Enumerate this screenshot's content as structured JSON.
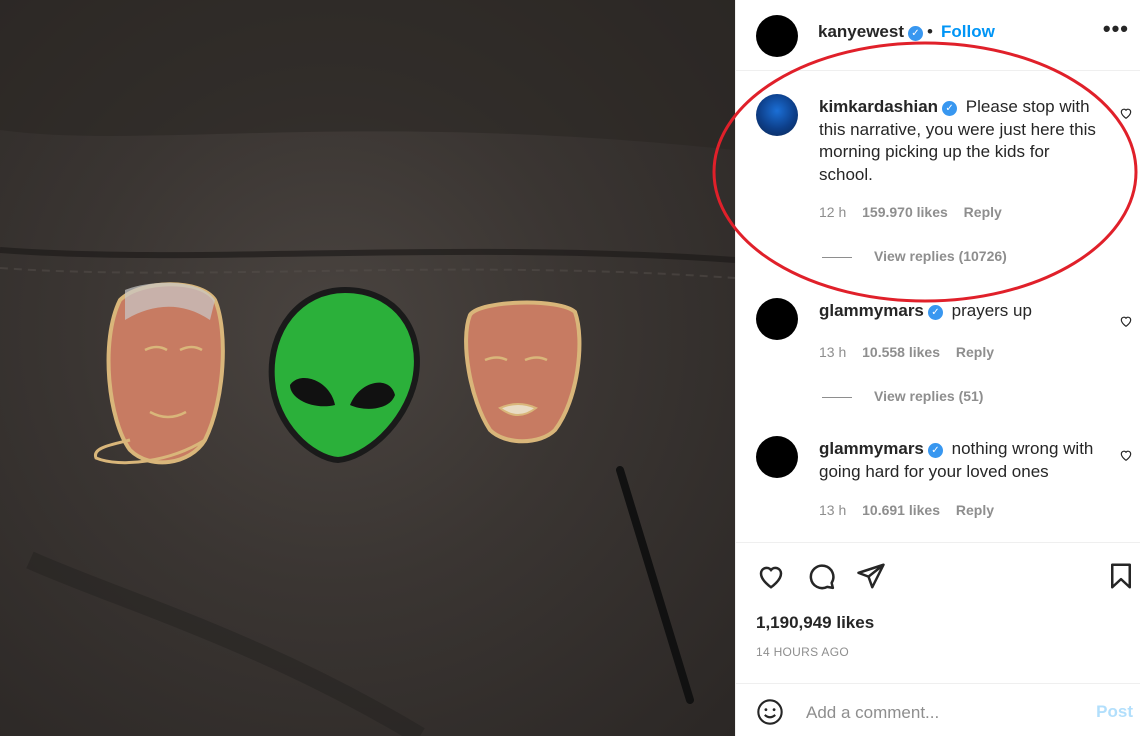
{
  "header": {
    "username": "kanyewest",
    "dot": "•",
    "follow_label": "Follow",
    "more_label": "•••"
  },
  "comments": [
    {
      "username": "kimkardashian",
      "text": "Please stop with this narrative, you were just here this morning picking up the kids for school.",
      "time": "12 h",
      "likes": "159.970 likes",
      "reply": "Reply",
      "view_replies": "View replies (10726)"
    },
    {
      "username": "glammymars",
      "text": "prayers up",
      "time": "13 h",
      "likes": "10.558 likes",
      "reply": "Reply",
      "view_replies": "View replies (51)"
    },
    {
      "username": "glammymars",
      "text": "nothing wrong with going hard for your loved ones",
      "time": "13 h",
      "likes": "10.691 likes",
      "reply": "Reply"
    }
  ],
  "post": {
    "likes": "1,190,949 likes",
    "time_ago": "14 HOURS AGO"
  },
  "add_comment": {
    "placeholder": "Add a comment...",
    "post_label": "Post"
  },
  "colors": {
    "accent": "#0095f6",
    "verified": "#3897f0",
    "annotation": "#e0202a",
    "alien_green": "#2bb03a"
  }
}
